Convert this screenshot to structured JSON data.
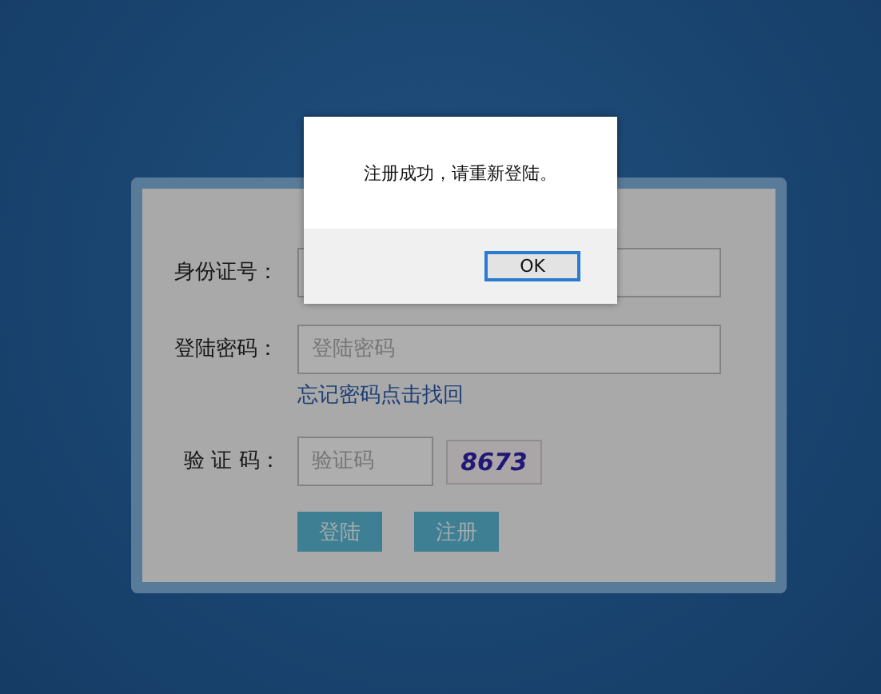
{
  "form": {
    "fields": [
      {
        "kind": "text",
        "label": "身份证号："
      },
      {
        "kind": "password",
        "label": "登陆密码：",
        "placeholder": "登陆密码",
        "link": "忘记密码点击找回"
      },
      {
        "kind": "captcha",
        "label": "验 证 码：",
        "placeholder": "验证码",
        "captcha": "8673"
      }
    ],
    "buttons": [
      "登陆",
      "注册"
    ]
  },
  "dialog": {
    "message": "注册成功，请重新登陆。",
    "buttons": [
      "OK"
    ]
  }
}
